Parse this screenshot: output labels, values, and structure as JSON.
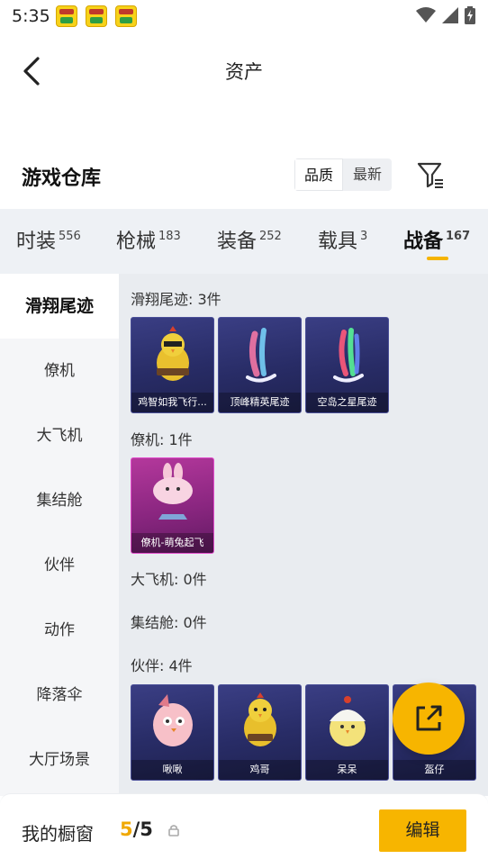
{
  "status": {
    "time": "5:35"
  },
  "header": {
    "title": "资产"
  },
  "section": {
    "title": "游戏仓库",
    "sort_options": [
      "品质",
      "最新"
    ],
    "sort_active": 0
  },
  "tabs": [
    {
      "label": "时装",
      "count": "556"
    },
    {
      "label": "枪械",
      "count": "183"
    },
    {
      "label": "装备",
      "count": "252"
    },
    {
      "label": "载具",
      "count": "3"
    },
    {
      "label": "战备",
      "count": "167",
      "active": true
    }
  ],
  "sidebar": {
    "items": [
      "滑翔尾迹",
      "僚机",
      "大飞机",
      "集结舱",
      "伙伴",
      "动作",
      "降落伞",
      "大厅场景"
    ],
    "active": 0
  },
  "groups": [
    {
      "label": "滑翔尾迹: 3件",
      "items": [
        "鸡智如我飞行...",
        "顶峰精英尾迹",
        "空岛之星尾迹"
      ]
    },
    {
      "label": "僚机: 1件",
      "items": [
        "僚机-萌兔起飞"
      ]
    },
    {
      "label": "大飞机: 0件",
      "items": []
    },
    {
      "label": "集结舱: 0件",
      "items": []
    },
    {
      "label": "伙伴: 4件",
      "items": [
        "啾啾",
        "鸡哥",
        "呆呆",
        "盔仔"
      ]
    }
  ],
  "showcase": {
    "label": "我的橱窗",
    "current": "5",
    "separator": "/",
    "total": "5"
  },
  "buttons": {
    "edit": "编辑"
  },
  "colors": {
    "accent": "#f7b500",
    "card_purple": "#2c306e",
    "card_pink": "#8a2680"
  },
  "icons": [
    "back-arrow-icon",
    "filter-icon",
    "share-icon",
    "lock-icon",
    "wifi-icon",
    "signal-icon",
    "battery-icon"
  ]
}
